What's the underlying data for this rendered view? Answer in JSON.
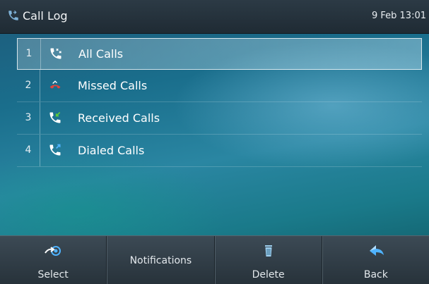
{
  "header": {
    "title": "Call Log",
    "title_icon": "phone-handset-icon",
    "datetime": "9 Feb 13:01"
  },
  "list": {
    "items": [
      {
        "number": "1",
        "label": "All Calls",
        "icon": "all-calls-icon",
        "selected": true
      },
      {
        "number": "2",
        "label": "Missed Calls",
        "icon": "missed-calls-icon",
        "selected": false
      },
      {
        "number": "3",
        "label": "Received Calls",
        "icon": "received-calls-icon",
        "selected": false
      },
      {
        "number": "4",
        "label": "Dialed Calls",
        "icon": "dialed-calls-icon",
        "selected": false
      }
    ]
  },
  "softkeys": [
    {
      "label": "Select",
      "icon": "select-arrow-icon"
    },
    {
      "label": "Notifications",
      "icon": ""
    },
    {
      "label": "Delete",
      "icon": "trash-icon"
    },
    {
      "label": "Back",
      "icon": "back-arrow-icon"
    }
  ],
  "colors": {
    "accent_blue": "#4fb3ff",
    "missed_red": "#e5433a",
    "received_green": "#5ccb3a"
  }
}
